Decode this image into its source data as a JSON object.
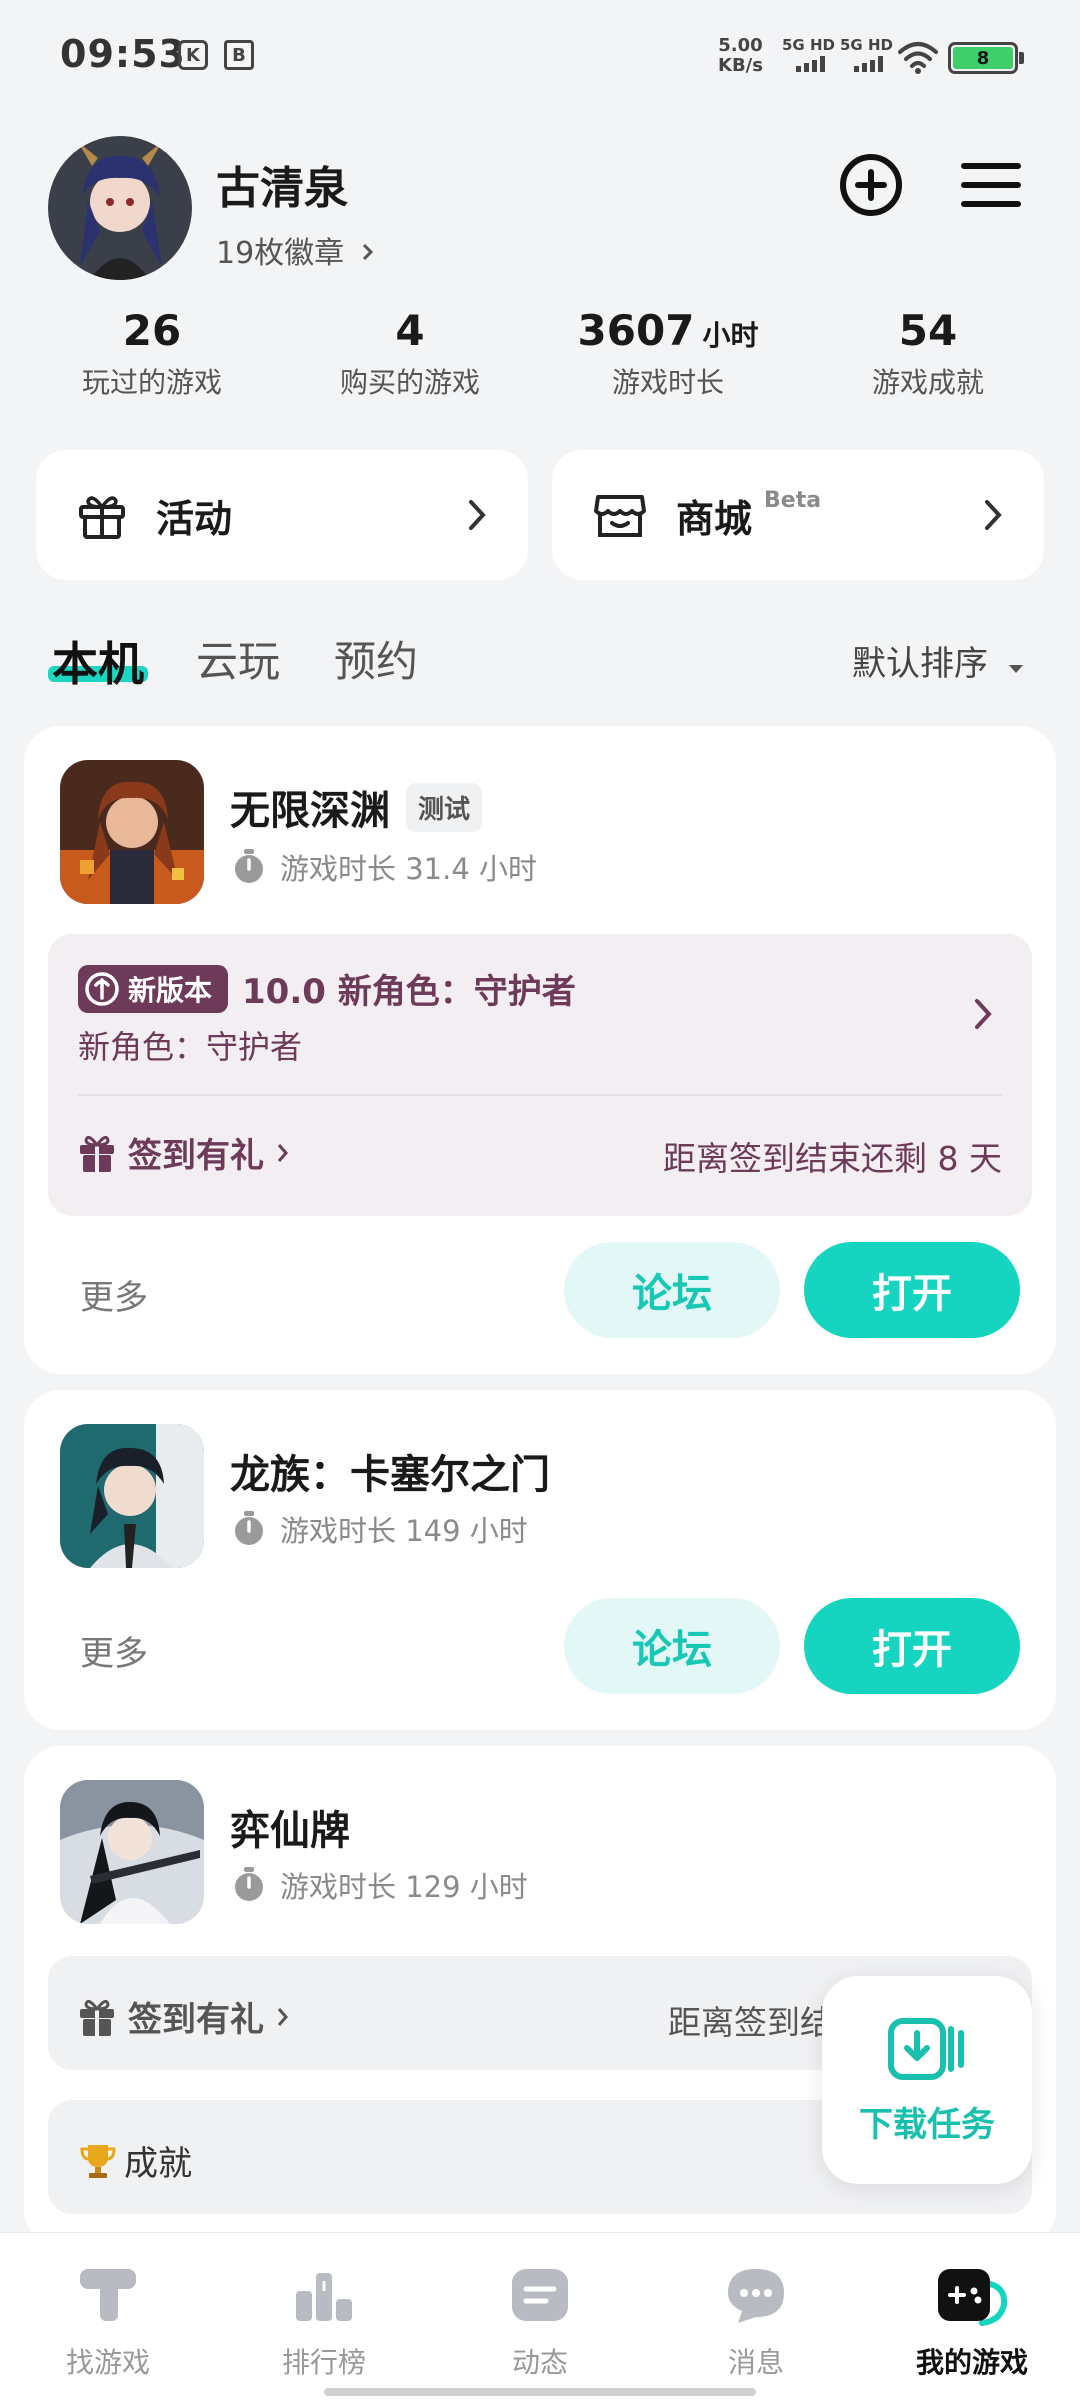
{
  "status_bar": {
    "time": "09:53",
    "net_speed_value": "5.00",
    "net_speed_unit": "KB/s",
    "sim1": "5G HD",
    "sim2": "5G HD",
    "battery": "8",
    "icon_k": "K",
    "icon_b": "B"
  },
  "profile": {
    "name": "古清泉",
    "badges": "19枚徽章",
    "add_icon": "plus-circle-icon",
    "menu_icon": "hamburger-menu-icon"
  },
  "stats": [
    {
      "value": "26",
      "unit": "",
      "label": "玩过的游戏"
    },
    {
      "value": "4",
      "unit": "",
      "label": "购买的游戏"
    },
    {
      "value": "3607",
      "unit": "小时",
      "label": "游戏时长"
    },
    {
      "value": "54",
      "unit": "",
      "label": "游戏成就"
    }
  ],
  "entries": {
    "activity": "活动",
    "shop": "商城",
    "shop_badge": "Beta"
  },
  "tabs": {
    "local": "本机",
    "cloud": "云玩",
    "reserve": "预约",
    "sort": "默认排序"
  },
  "games": [
    {
      "title": "无限深渊",
      "tag": "测试",
      "playtime": "游戏时长 31.4 小时",
      "new_version_badge": "新版本",
      "new_version_title": "10.0 新角色：守护者",
      "new_version_sub": "新角色：守护者",
      "signin": "签到有礼",
      "signin_end": "距离签到结束还剩 8 天",
      "more": "更多",
      "forum": "论坛",
      "open": "打开"
    },
    {
      "title": "龙族：卡塞尔之门",
      "playtime": "游戏时长 149 小时",
      "more": "更多",
      "forum": "论坛",
      "open": "打开"
    },
    {
      "title": "弈仙牌",
      "playtime": "游戏时长 129 小时",
      "signin": "签到有礼",
      "signin_end": "距离签到结",
      "achievement": "成就"
    }
  ],
  "float_download": {
    "label": "下载任务"
  },
  "nav": [
    {
      "label": "找游戏",
      "icon": "find-game-icon"
    },
    {
      "label": "排行榜",
      "icon": "leaderboard-icon"
    },
    {
      "label": "动态",
      "icon": "feed-icon"
    },
    {
      "label": "消息",
      "icon": "message-icon"
    },
    {
      "label": "我的游戏",
      "icon": "my-games-icon"
    }
  ],
  "colors": {
    "accent": "#15d5c0",
    "event_text": "#6d3a5a",
    "background": "#f3f4f6"
  }
}
